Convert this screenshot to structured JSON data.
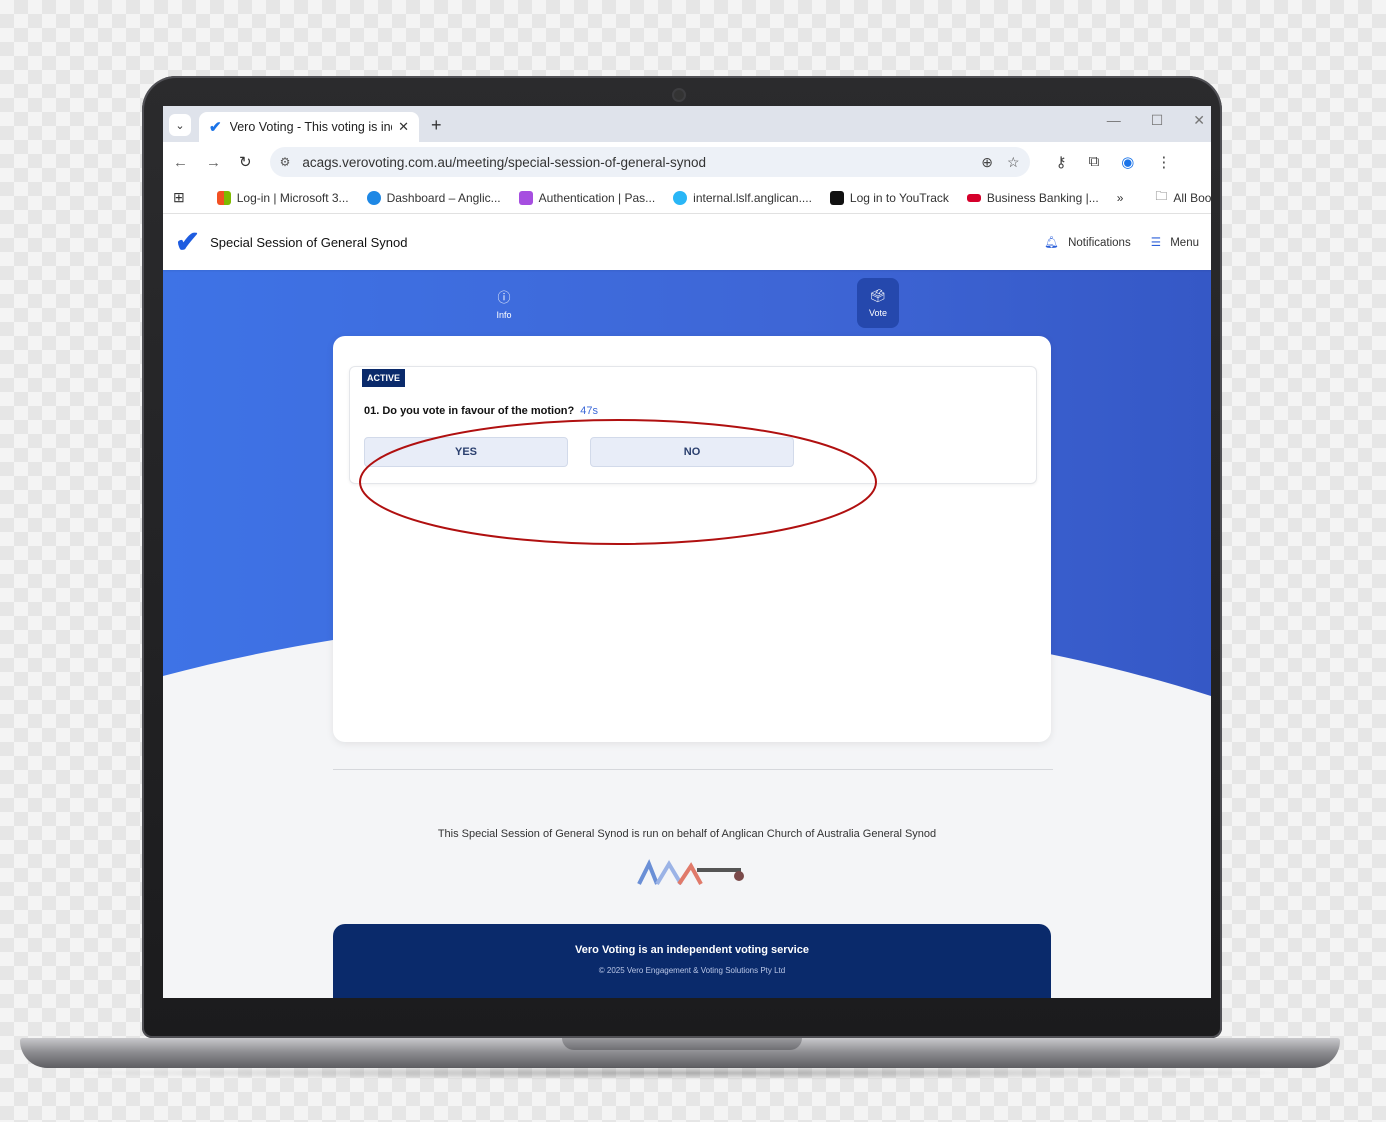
{
  "browser": {
    "tab_title": "Vero Voting - This voting is inde",
    "new_tab": "+",
    "url": "acags.verovoting.com.au/meeting/special-session-of-general-synod",
    "bookmarks": [
      {
        "label": "Log-in | Microsoft 3...",
        "color": "#f25022"
      },
      {
        "label": "Dashboard – Anglic...",
        "color": "#1e88e5"
      },
      {
        "label": "Authentication | Pas...",
        "color": "#a64ee0"
      },
      {
        "label": "internal.lslf.anglican....",
        "color": "#29b6f6"
      },
      {
        "label": "Log in to YouTrack",
        "color": "#111111"
      },
      {
        "label": "Business Banking |...",
        "color": "#d5002b"
      }
    ],
    "bookmarks_overflow": "»",
    "all_bookmarks": "All Bookmarks"
  },
  "app": {
    "title": "Special Session of General Synod",
    "notifications_label": "Notifications",
    "menu_label": "Menu",
    "nav": {
      "info_label": "Info",
      "vote_label": "Vote"
    },
    "question": {
      "status_badge": "ACTIVE",
      "text": "01. Do you vote in favour of the motion?",
      "timer": "47s",
      "yes_label": "YES",
      "no_label": "NO"
    },
    "footer": {
      "note": "This Special Session of General Synod is run on behalf of Anglican Church of Australia General Synod",
      "bar_title": "Vero Voting is an independent voting service",
      "copyright": "© 2025 Vero Engagement & Voting Solutions Pty Ltd"
    }
  },
  "colors": {
    "hero_blue": "#3e73e6",
    "navy": "#0a2a6b",
    "annotation_red": "#b01010",
    "accent": "#3b68d8"
  }
}
